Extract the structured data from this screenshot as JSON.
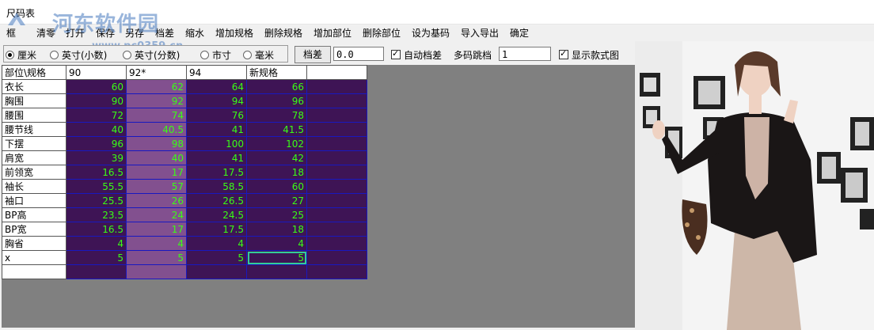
{
  "window": {
    "title": "尺码表"
  },
  "watermark": {
    "brand": "河东软件园",
    "url": "www.pc0359.cn"
  },
  "menu": [
    {
      "label": "框"
    },
    {
      "label": "清零"
    },
    {
      "label": "打开"
    },
    {
      "label": "保存"
    },
    {
      "label": "另存"
    },
    {
      "label": "档差"
    },
    {
      "label": "缩水"
    },
    {
      "label": "增加规格"
    },
    {
      "label": "删除规格"
    },
    {
      "label": "增加部位"
    },
    {
      "label": "删除部位"
    },
    {
      "label": "设为基码"
    },
    {
      "label": "导入导出"
    },
    {
      "label": "确定"
    }
  ],
  "units": [
    {
      "label": "厘米",
      "selected": true
    },
    {
      "label": "英寸(小数)",
      "selected": false
    },
    {
      "label": "英寸(分数)",
      "selected": false
    },
    {
      "label": "市寸",
      "selected": false
    },
    {
      "label": "毫米",
      "selected": false
    }
  ],
  "toolbar": {
    "grade_button": "档差",
    "grade_value": "0.0",
    "auto_grade": {
      "label": "自动档差",
      "checked": true
    },
    "multi_jump_label": "多码跳档",
    "multi_jump_value": "1",
    "show_style_image": {
      "label": "显示款式图",
      "checked": true
    }
  },
  "table": {
    "corner": "部位\\规格",
    "columns": [
      "90",
      "92*",
      "94",
      "新规格",
      ""
    ],
    "rows": [
      {
        "label": "衣长",
        "values": [
          "60",
          "62",
          "64",
          "66"
        ]
      },
      {
        "label": "胸围",
        "values": [
          "90",
          "92",
          "94",
          "96"
        ]
      },
      {
        "label": "腰围",
        "values": [
          "72",
          "74",
          "76",
          "78"
        ]
      },
      {
        "label": "腰节线",
        "values": [
          "40",
          "40.5",
          "41",
          "41.5"
        ]
      },
      {
        "label": "下摆",
        "values": [
          "96",
          "98",
          "100",
          "102"
        ]
      },
      {
        "label": "肩宽",
        "values": [
          "39",
          "40",
          "41",
          "42"
        ]
      },
      {
        "label": "前领宽",
        "values": [
          "16.5",
          "17",
          "17.5",
          "18"
        ]
      },
      {
        "label": "袖长",
        "values": [
          "55.5",
          "57",
          "58.5",
          "60"
        ]
      },
      {
        "label": "袖口",
        "values": [
          "25.5",
          "26",
          "26.5",
          "27"
        ]
      },
      {
        "label": "BP高",
        "values": [
          "23.5",
          "24",
          "24.5",
          "25"
        ]
      },
      {
        "label": "BP宽",
        "values": [
          "16.5",
          "17",
          "17.5",
          "18"
        ]
      },
      {
        "label": "胸省",
        "values": [
          "4",
          "4",
          "4",
          "4"
        ]
      },
      {
        "label": "x",
        "values": [
          "5",
          "5",
          "5",
          "5"
        ]
      },
      {
        "label": "",
        "values": [
          "",
          "",
          "",
          ""
        ]
      }
    ],
    "base_column_index": 1,
    "selected_cell": {
      "row": 12,
      "col": 3
    }
  },
  "colors": {
    "cell_bg": "#3e1455",
    "base_col_bg": "#82508f",
    "cell_text": "#39ff14",
    "grid_line": "#1818c0",
    "panel_bg": "#808080"
  },
  "style_image": {
    "icon": "style-photo"
  }
}
